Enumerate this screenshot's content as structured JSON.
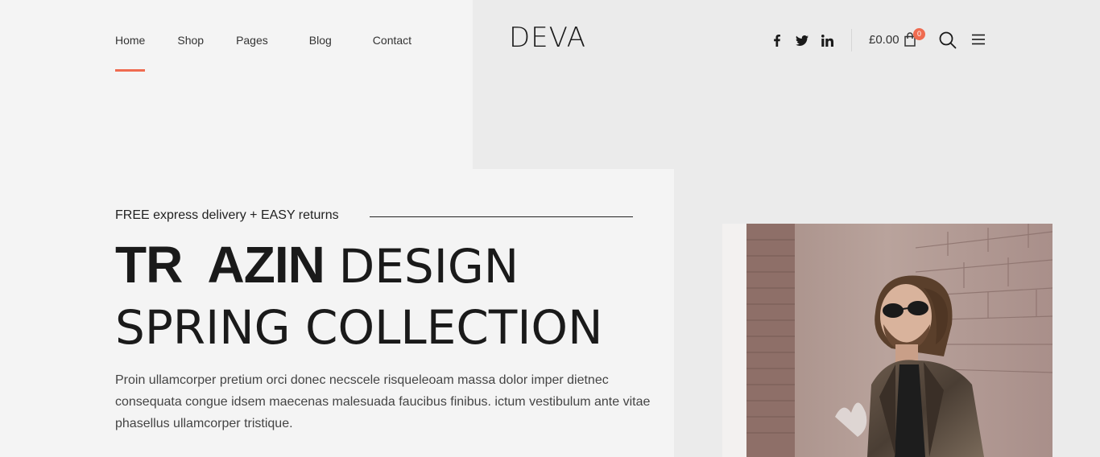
{
  "nav": {
    "items": [
      {
        "label": "Home",
        "active": true
      },
      {
        "label": "Shop",
        "active": false
      },
      {
        "label": "Pages",
        "active": false
      },
      {
        "label": "Blog",
        "active": false
      },
      {
        "label": "Contact",
        "active": false
      }
    ],
    "active_color": "#ef6b50"
  },
  "logo": {
    "text": "DEVA"
  },
  "social": [
    {
      "icon": "facebook-icon"
    },
    {
      "icon": "twitter-icon"
    },
    {
      "icon": "linkedin-icon"
    }
  ],
  "cart": {
    "total": "£0.00",
    "count": "0",
    "badge_color": "#ef6b50"
  },
  "hero": {
    "tagline": "FREE express delivery + EASY returns",
    "headline_bold": "TR  AZIN",
    "headline_light": "DESIGN",
    "headline_line2": "SPRING COLLECTION",
    "description": "Proin ullamcorper pretium orci donec necscele risqueleoam massa dolor imper dietnec consequata congue idsem maecenas malesuada faucibus finibus. ictum vestibulum ante vitae phasellus ullamcorper tristique."
  }
}
